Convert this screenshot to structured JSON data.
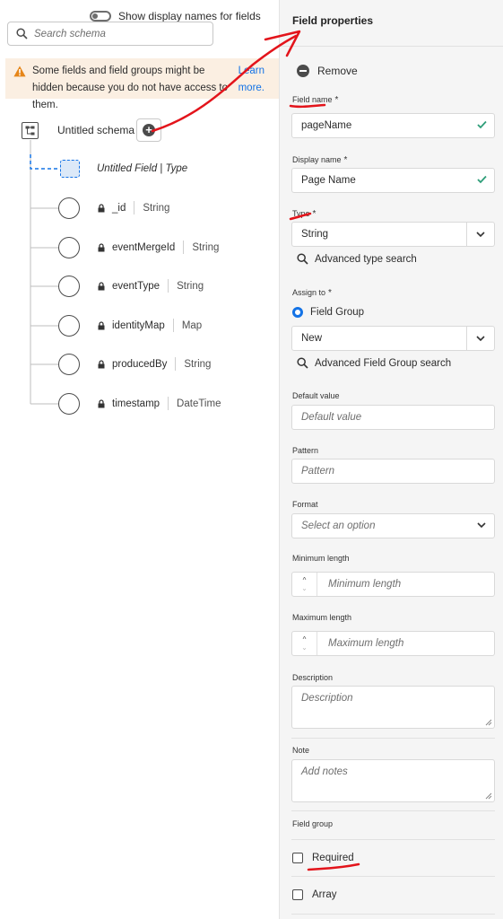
{
  "left": {
    "toggle_label": "Show display names for fields",
    "search_placeholder": "Search schema",
    "warning": {
      "message": "Some fields and field groups might be hidden because you do not have access to them.",
      "link_line1": "Learn",
      "link_line2": "more."
    },
    "schema": {
      "root_label": "Untitled schema",
      "new_field_label": "Untitled Field | Type",
      "fields": [
        {
          "name": "_id",
          "type": "String"
        },
        {
          "name": "eventMergeId",
          "type": "String"
        },
        {
          "name": "eventType",
          "type": "String"
        },
        {
          "name": "identityMap",
          "type": "Map"
        },
        {
          "name": "producedBy",
          "type": "String"
        },
        {
          "name": "timestamp",
          "type": "DateTime"
        }
      ]
    }
  },
  "right": {
    "title": "Field properties",
    "remove_label": "Remove",
    "field_name": {
      "label": "Field name",
      "value": "pageName"
    },
    "display_name": {
      "label": "Display name",
      "value": "Page Name"
    },
    "type": {
      "label": "Type",
      "value": "String"
    },
    "advanced_type_search": "Advanced type search",
    "assign_to": {
      "label": "Assign to",
      "option": "Field Group",
      "value": "New"
    },
    "advanced_field_group_search": "Advanced Field Group search",
    "default_value": {
      "label": "Default value",
      "placeholder": "Default value"
    },
    "pattern": {
      "label": "Pattern",
      "placeholder": "Pattern"
    },
    "format": {
      "label": "Format",
      "placeholder": "Select an option"
    },
    "min_length": {
      "label": "Minimum length",
      "placeholder": "Minimum length"
    },
    "max_length": {
      "label": "Maximum length",
      "placeholder": "Maximum length"
    },
    "description": {
      "label": "Description",
      "placeholder": "Description"
    },
    "note": {
      "label": "Note",
      "placeholder": "Add notes"
    },
    "field_group_label": "Field group",
    "required_label": "Required",
    "array_label": "Array",
    "required_star": "*"
  },
  "colors": {
    "accent": "#1473e6",
    "annotation": "#e3141b",
    "valid_check": "#2d9d78",
    "warning": "#e68619",
    "warning_bg": "#fbefe2"
  }
}
